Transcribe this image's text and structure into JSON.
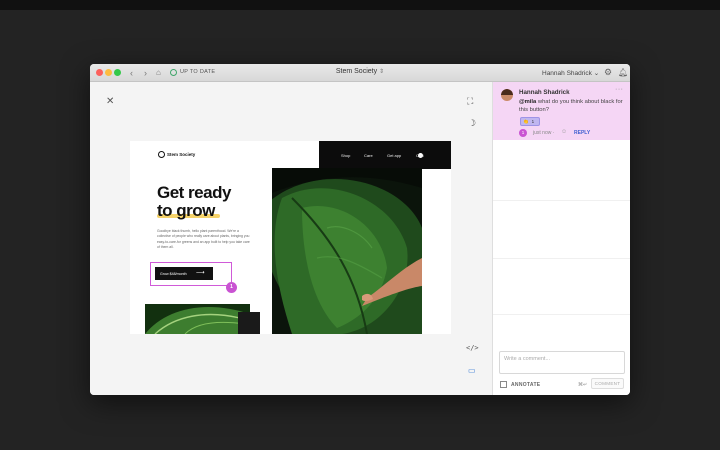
{
  "window": {
    "status": "UP TO DATE",
    "title": "Stem Society",
    "user": "Hannah Shadrick"
  },
  "mock": {
    "logo": "Stem Society",
    "nav": [
      "Shop",
      "Care",
      "Get app",
      "Cart"
    ],
    "headline_line1": "Get ready",
    "headline_line2": "to grow",
    "body": "Goodbye black thumb, hello plant parenthood. We're a collective of people who really care about plants, bringing you easy-to-care-for greens and an app built to help you take care of them all.",
    "cta": "Grow $48/month",
    "selection_index": "1"
  },
  "comment": {
    "author": "Hannah Shadrick",
    "mention": "@mila",
    "text": " what do you think about black for this button?",
    "reaction_emoji": "👏",
    "reaction_count": "1",
    "index": "1",
    "time": "just now ·",
    "reply": "REPLY"
  },
  "composer": {
    "placeholder": "Write a comment...",
    "annotate": "ANNOTATE",
    "shortcut": "⌘↵",
    "button": "COMMENT"
  },
  "colors": {
    "accent": "#c953d2",
    "comment_bg": "#f5d6f5",
    "link": "#3f5fd1",
    "highlight": "#f6d36a"
  }
}
